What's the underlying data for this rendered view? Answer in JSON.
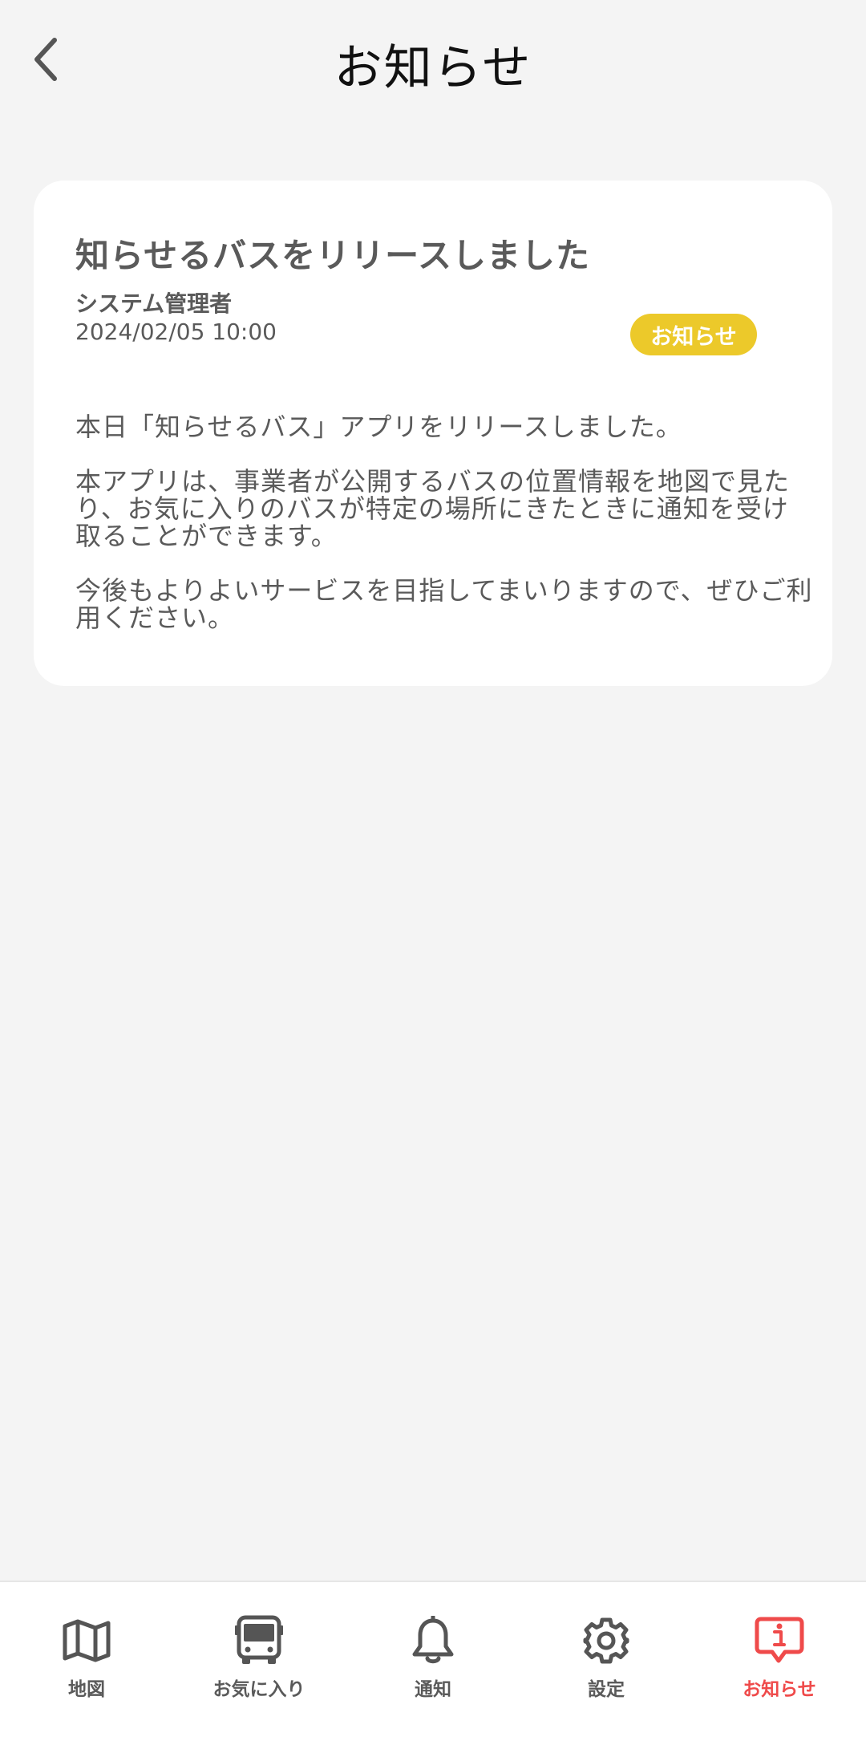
{
  "header": {
    "title": "お知らせ"
  },
  "notice": {
    "title": "知らせるバスをリリースしました",
    "author": "システム管理者",
    "date": "2024/02/05 10:00",
    "badge": "お知らせ",
    "paragraphs": [
      "本日「知らせるバス」アプリをリリースしました。",
      "本アプリは、事業者が公開するバスの位置情報を地図で見たり、お気に入りのバスが特定の場所にきたときに通知を受け取ることができます。",
      "今後もよりよいサービスを目指してまいりますので、ぜひご利用ください。"
    ]
  },
  "tabbar": {
    "items": [
      {
        "label": "地図",
        "icon": "map-icon"
      },
      {
        "label": "お気に入り",
        "icon": "bus-icon"
      },
      {
        "label": "通知",
        "icon": "bell-icon"
      },
      {
        "label": "設定",
        "icon": "gear-icon"
      },
      {
        "label": "お知らせ",
        "icon": "info-message-icon",
        "active": true
      }
    ]
  },
  "colors": {
    "badge": "#ecc92a",
    "active_tab": "#ef4a4a",
    "text": "#5a5a5a",
    "background": "#f4f4f4"
  }
}
